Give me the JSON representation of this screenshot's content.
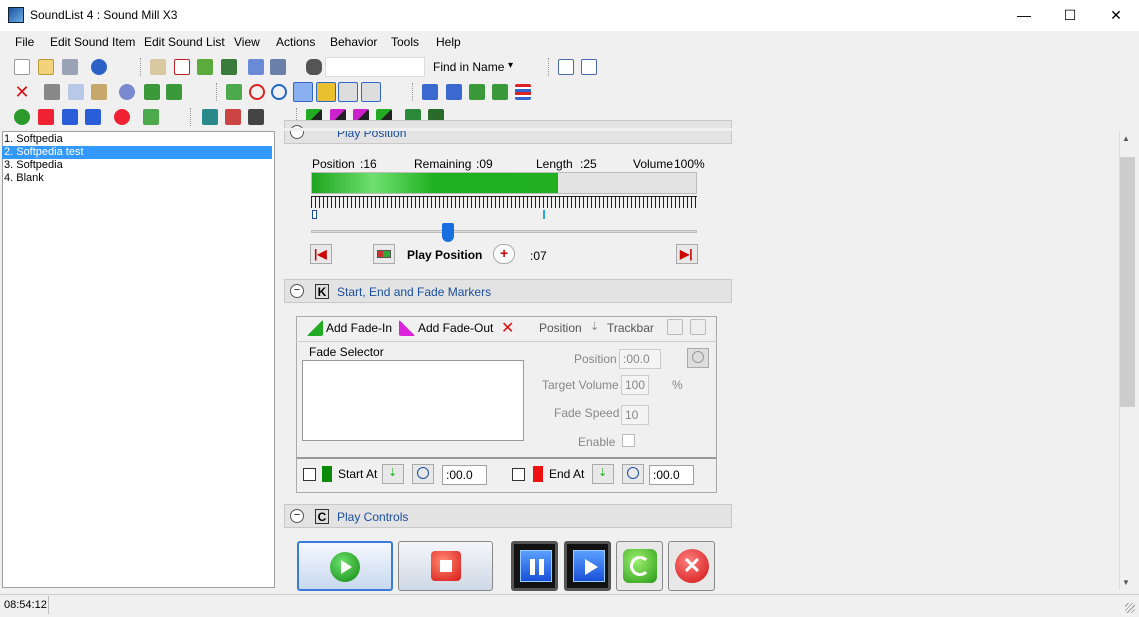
{
  "window": {
    "title": "SoundList 4 : Sound Mill X3",
    "minimize": "—",
    "maximize": "☐",
    "close": "✕"
  },
  "menu": [
    "File",
    "Edit Sound Item",
    "Edit Sound List",
    "View",
    "Actions",
    "Behavior",
    "Tools",
    "Help"
  ],
  "toolbar": {
    "find_mode": "Find in Name",
    "find_arrow": "▾"
  },
  "sound_list": [
    "1. Softpedia",
    "2. Softpedia test",
    "3. Softpedia",
    "4. Blank"
  ],
  "play_position": {
    "header_title": "Play Position",
    "position_label": "Position",
    "position_value": ":16",
    "remaining_label": "Remaining",
    "remaining_value": ":09",
    "length_label": "Length",
    "length_value": ":25",
    "volume_label": "Volume",
    "volume_value": "100%",
    "progress": 0.64,
    "play_position_label": "Play Position",
    "offset_value": ":07",
    "first_glyph": "|◀",
    "last_glyph": "▶|"
  },
  "markers": {
    "header_letter": "K",
    "header_title": "Start, End and Fade Markers",
    "add_fade_in": "Add Fade-In",
    "add_fade_out": "Add Fade-Out",
    "delete_glyph": "✕",
    "position_label": "Position",
    "trackbar_label": "Trackbar",
    "fade_selector_label": "Fade Selector",
    "pos_label": "Position",
    "pos_value": ":00.0",
    "target_volume_label": "Target Volume",
    "target_volume_value": "100",
    "percent": "%",
    "fade_speed_label": "Fade Speed",
    "fade_speed_value": "10",
    "enable_label": "Enable",
    "start_at_label": "Start At",
    "start_at_value": ":00.0",
    "end_at_label": "End At",
    "end_at_value": ":00.0"
  },
  "play_controls": {
    "header_letter": "C",
    "header_title": "Play Controls"
  },
  "status": {
    "time": "08:54:12"
  },
  "colors": {
    "accent_blue": "#1a4fa0",
    "selection": "#3399ff",
    "progress_green": "#22bb22",
    "start_marker": "#0a8a0a",
    "end_marker": "#ee1111"
  }
}
